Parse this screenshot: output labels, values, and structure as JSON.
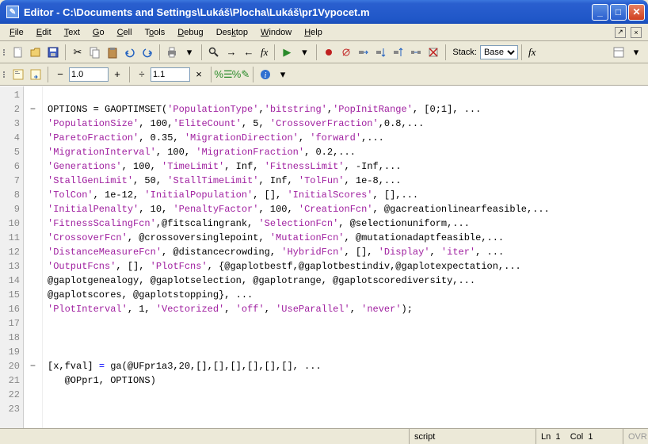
{
  "window": {
    "title": "Editor - C:\\Documents and Settings\\Lukáš\\Plocha\\Lukáš\\pr1Vypocet.m"
  },
  "menu": {
    "file": "File",
    "edit": "Edit",
    "text": "Text",
    "go": "Go",
    "cell": "Cell",
    "tools": "Tools",
    "debug": "Debug",
    "desktop": "Desktop",
    "window": "Window",
    "help": "Help"
  },
  "toolbar": {
    "stack_label": "Stack:",
    "stack_value": "Base",
    "cell_minus": "−",
    "cell_plus": "+",
    "cell_div": "÷",
    "cell_times": "×",
    "val1": "1.0",
    "val2": "1.1"
  },
  "status": {
    "type": "script",
    "ln_label": "Ln",
    "ln": "1",
    "col_label": "Col",
    "col": "1",
    "ovr": "OVR"
  },
  "code": {
    "lines": [
      {
        "n": 1,
        "fold": "",
        "pre": "",
        "segs": []
      },
      {
        "n": 2,
        "fold": "−",
        "pre": "OPTIONS = GAOPTIMSET(",
        "segs": [
          {
            "t": "str",
            "v": "'PopulationType'"
          },
          {
            "t": "p",
            "v": ","
          },
          {
            "t": "str",
            "v": "'bitstring'"
          },
          {
            "t": "p",
            "v": ","
          },
          {
            "t": "str",
            "v": "'PopInitRange'"
          },
          {
            "t": "p",
            "v": ", [0;1], ..."
          }
        ]
      },
      {
        "n": 3,
        "fold": "",
        "pre": "",
        "segs": [
          {
            "t": "str",
            "v": "'PopulationSize'"
          },
          {
            "t": "p",
            "v": ", 100,"
          },
          {
            "t": "str",
            "v": "'EliteCount'"
          },
          {
            "t": "p",
            "v": ", 5, "
          },
          {
            "t": "str",
            "v": "'CrossoverFraction'"
          },
          {
            "t": "p",
            "v": ",0.8,..."
          }
        ]
      },
      {
        "n": 4,
        "fold": "",
        "pre": "",
        "segs": [
          {
            "t": "str",
            "v": "'ParetoFraction'"
          },
          {
            "t": "p",
            "v": ", 0.35, "
          },
          {
            "t": "str",
            "v": "'MigrationDirection'"
          },
          {
            "t": "p",
            "v": ", "
          },
          {
            "t": "str",
            "v": "'forward'"
          },
          {
            "t": "p",
            "v": ",..."
          }
        ]
      },
      {
        "n": 5,
        "fold": "",
        "pre": "",
        "segs": [
          {
            "t": "str",
            "v": "'MigrationInterval'"
          },
          {
            "t": "p",
            "v": ", 100, "
          },
          {
            "t": "str",
            "v": "'MigrationFraction'"
          },
          {
            "t": "p",
            "v": ", 0.2,..."
          }
        ]
      },
      {
        "n": 6,
        "fold": "",
        "pre": "",
        "segs": [
          {
            "t": "str",
            "v": "'Generations'"
          },
          {
            "t": "p",
            "v": ", 100, "
          },
          {
            "t": "str",
            "v": "'TimeLimit'"
          },
          {
            "t": "p",
            "v": ", Inf, "
          },
          {
            "t": "str",
            "v": "'FitnessLimit'"
          },
          {
            "t": "p",
            "v": ", -Inf,..."
          }
        ]
      },
      {
        "n": 7,
        "fold": "",
        "pre": "",
        "segs": [
          {
            "t": "str",
            "v": "'StallGenLimit'"
          },
          {
            "t": "p",
            "v": ", 50, "
          },
          {
            "t": "str",
            "v": "'StallTimeLimit'"
          },
          {
            "t": "p",
            "v": ", Inf, "
          },
          {
            "t": "str",
            "v": "'TolFun'"
          },
          {
            "t": "p",
            "v": ", 1e-8,..."
          }
        ]
      },
      {
        "n": 8,
        "fold": "",
        "pre": "",
        "segs": [
          {
            "t": "str",
            "v": "'TolCon'"
          },
          {
            "t": "p",
            "v": ", 1e-12, "
          },
          {
            "t": "str",
            "v": "'InitialPopulation'"
          },
          {
            "t": "p",
            "v": ", [], "
          },
          {
            "t": "str",
            "v": "'InitialScores'"
          },
          {
            "t": "p",
            "v": ", [],..."
          }
        ]
      },
      {
        "n": 9,
        "fold": "",
        "pre": "",
        "segs": [
          {
            "t": "str",
            "v": "'InitialPenalty'"
          },
          {
            "t": "p",
            "v": ", 10, "
          },
          {
            "t": "str",
            "v": "'PenaltyFactor'"
          },
          {
            "t": "p",
            "v": ", 100, "
          },
          {
            "t": "str",
            "v": "'CreationFcn'"
          },
          {
            "t": "p",
            "v": ", @gacreationlinearfeasible,..."
          }
        ]
      },
      {
        "n": 10,
        "fold": "",
        "pre": "",
        "segs": [
          {
            "t": "str",
            "v": "'FitnessScalingFcn'"
          },
          {
            "t": "p",
            "v": ",@fitscalingrank, "
          },
          {
            "t": "str",
            "v": "'SelectionFcn'"
          },
          {
            "t": "p",
            "v": ", @selectionuniform,..."
          }
        ]
      },
      {
        "n": 11,
        "fold": "",
        "pre": "",
        "segs": [
          {
            "t": "str",
            "v": "'CrossoverFcn'"
          },
          {
            "t": "p",
            "v": ", @crossoversinglepoint, "
          },
          {
            "t": "str",
            "v": "'MutationFcn'"
          },
          {
            "t": "p",
            "v": ", @mutationadaptfeasible,..."
          }
        ]
      },
      {
        "n": 12,
        "fold": "",
        "pre": "",
        "segs": [
          {
            "t": "str",
            "v": "'DistanceMeasureFcn'"
          },
          {
            "t": "p",
            "v": ", @distancecrowding, "
          },
          {
            "t": "str",
            "v": "'HybridFcn'"
          },
          {
            "t": "p",
            "v": ", [], "
          },
          {
            "t": "str",
            "v": "'Display'"
          },
          {
            "t": "p",
            "v": ", "
          },
          {
            "t": "str",
            "v": "'iter'"
          },
          {
            "t": "p",
            "v": ", ..."
          }
        ]
      },
      {
        "n": 13,
        "fold": "",
        "pre": "",
        "segs": [
          {
            "t": "str",
            "v": "'OutputFcns'"
          },
          {
            "t": "p",
            "v": ", [], "
          },
          {
            "t": "str",
            "v": "'PlotFcns'"
          },
          {
            "t": "p",
            "v": ", {@gaplotbestf,@gaplotbestindiv,@gaplotexpectation,..."
          }
        ]
      },
      {
        "n": 14,
        "fold": "",
        "pre": "@gaplotgenealogy, @gaplotselection, @gaplotrange, @gaplotscorediversity,...",
        "segs": []
      },
      {
        "n": 15,
        "fold": "",
        "pre": "@gaplotscores, @gaplotstopping}, ...",
        "segs": []
      },
      {
        "n": 16,
        "fold": "",
        "pre": "",
        "segs": [
          {
            "t": "str",
            "v": "'PlotInterval'"
          },
          {
            "t": "p",
            "v": ", 1, "
          },
          {
            "t": "str",
            "v": "'Vectorized'"
          },
          {
            "t": "p",
            "v": ", "
          },
          {
            "t": "str",
            "v": "'off'"
          },
          {
            "t": "p",
            "v": ", "
          },
          {
            "t": "str",
            "v": "'UseParallel'"
          },
          {
            "t": "p",
            "v": ", "
          },
          {
            "t": "str",
            "v": "'never'"
          },
          {
            "t": "p",
            "v": ");"
          }
        ]
      },
      {
        "n": 17,
        "fold": "",
        "pre": "",
        "segs": []
      },
      {
        "n": 18,
        "fold": "",
        "pre": "",
        "segs": []
      },
      {
        "n": 19,
        "fold": "",
        "pre": "",
        "segs": []
      },
      {
        "n": 20,
        "fold": "−",
        "pre": "",
        "segs": [
          {
            "t": "p",
            "v": "[x,fval] "
          },
          {
            "t": "kw",
            "v": "="
          },
          {
            "t": "p",
            "v": " ga(@UFpr1a3,20,[],[],[],[],[],[], ..."
          }
        ]
      },
      {
        "n": 21,
        "fold": "",
        "pre": "   @OPpr1, OPTIONS)",
        "segs": []
      },
      {
        "n": 22,
        "fold": "",
        "pre": "",
        "segs": []
      },
      {
        "n": 23,
        "fold": "",
        "pre": "",
        "segs": []
      }
    ]
  }
}
